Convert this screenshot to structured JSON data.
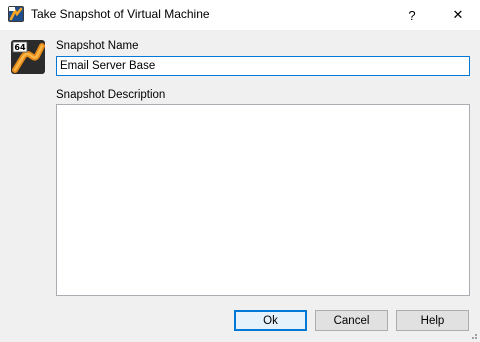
{
  "window": {
    "title": "Take Snapshot of Virtual Machine",
    "help_glyph": "?",
    "close_glyph": "✕",
    "icon": "virtualbox-icon"
  },
  "vm_icon": {
    "icon": "vm-64bit-icon",
    "badge": "64"
  },
  "form": {
    "name_label": "Snapshot Name",
    "name_value": "Email Server Base",
    "description_label": "Snapshot Description",
    "description_value": ""
  },
  "buttons": {
    "ok": "Ok",
    "cancel": "Cancel",
    "help": "Help"
  },
  "colors": {
    "accent": "#0078d7",
    "window_bg": "#f0f0f0",
    "button_bg": "#e1e1e1"
  }
}
